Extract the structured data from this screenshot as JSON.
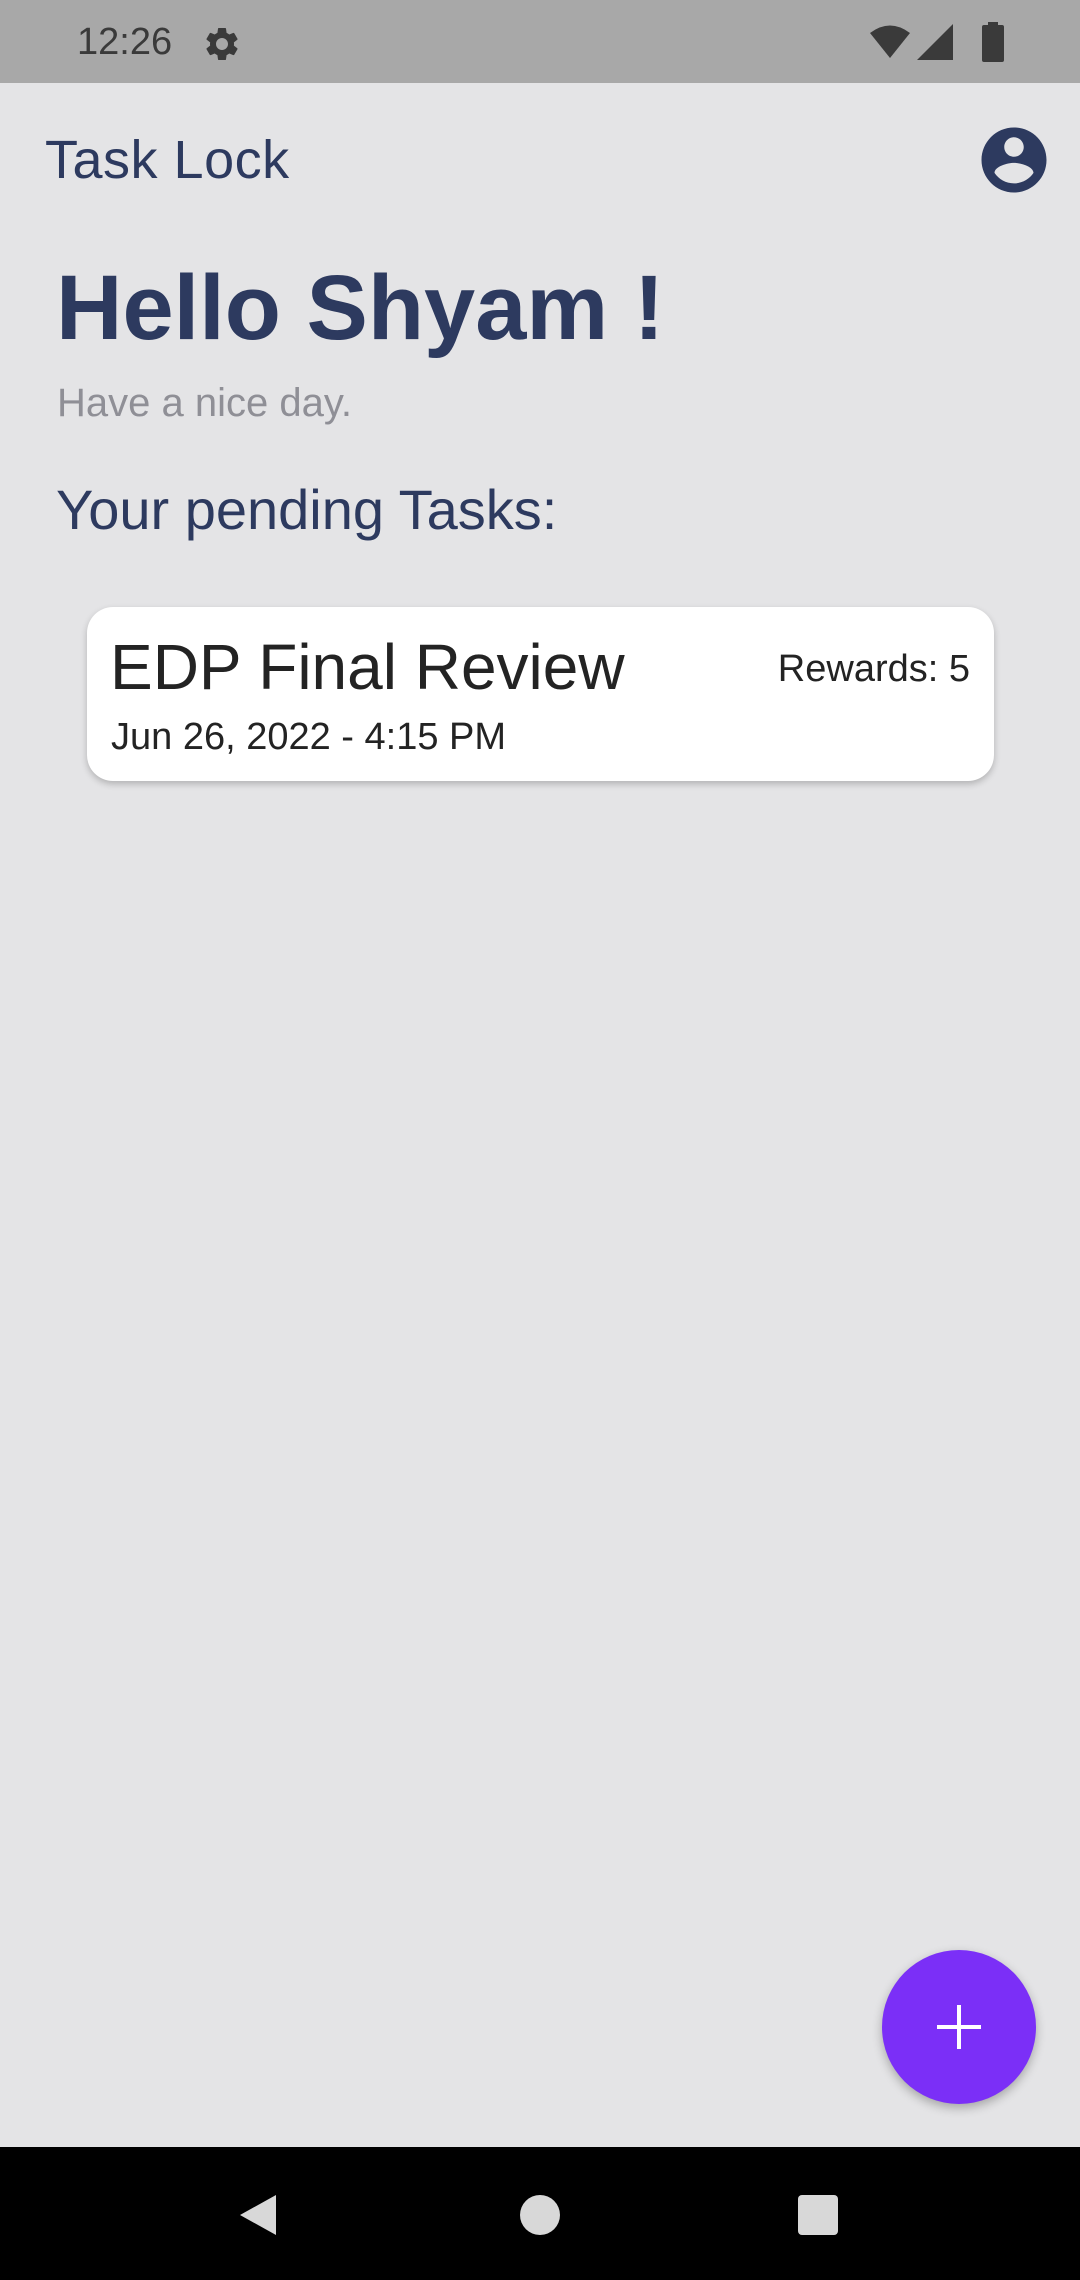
{
  "status_bar": {
    "time": "12:26",
    "icons": [
      "settings-gear-icon",
      "wifi-icon",
      "cell-signal-icon",
      "battery-icon"
    ]
  },
  "app_bar": {
    "title": "Task Lock",
    "avatar_icon": "account-circle-icon"
  },
  "greeting": {
    "title": "Hello Shyam !",
    "subtitle": "Have a nice day."
  },
  "section": {
    "title": "Your pending Tasks:"
  },
  "tasks": [
    {
      "title": "EDP Final Review",
      "rewards": "Rewards: 5",
      "datetime": "Jun 26, 2022 - 4:15 PM"
    }
  ],
  "fab": {
    "icon": "plus-icon"
  },
  "nav_bar": {
    "buttons": [
      "back-icon",
      "home-icon",
      "recents-icon"
    ]
  },
  "colors": {
    "background": "#e4e4e6",
    "primary_text": "#2d3a5f",
    "muted_text": "#8f8f96",
    "fab": "#7b2ff7",
    "status_bar": "#a8a8a8",
    "nav_bar": "#000000"
  }
}
